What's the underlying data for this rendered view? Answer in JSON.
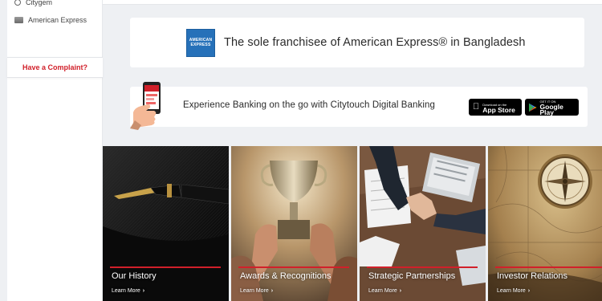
{
  "sidebar": {
    "items": [
      {
        "label": "Citygem",
        "icon": "citygem-icon"
      },
      {
        "label": "American Express",
        "icon": "amex-card-icon"
      }
    ],
    "complaint_label": "Have a Complaint?"
  },
  "amex_banner": {
    "logo_lines": [
      "AMERICAN",
      "EXPRESS"
    ],
    "text": "The sole franchisee of American Express® in Bangladesh"
  },
  "citytouch_banner": {
    "text": "Experience Banking on the go with Citytouch Digital Banking",
    "app_store": {
      "small": "Download on the",
      "big": "App Store"
    },
    "google_play": {
      "small": "GET IT ON",
      "big": "Google Play"
    }
  },
  "cards": [
    {
      "title": "Our History",
      "link": "Learn More"
    },
    {
      "title": "Awards & Recognitions",
      "link": "Learn More"
    },
    {
      "title": "Strategic Partnerships",
      "link": "Learn More"
    },
    {
      "title": "Investor Relations",
      "link": "Learn More"
    }
  ],
  "colors": {
    "accent_red": "#d1202a",
    "amex_blue": "#2671b9",
    "page_bg": "#eef0f3"
  }
}
